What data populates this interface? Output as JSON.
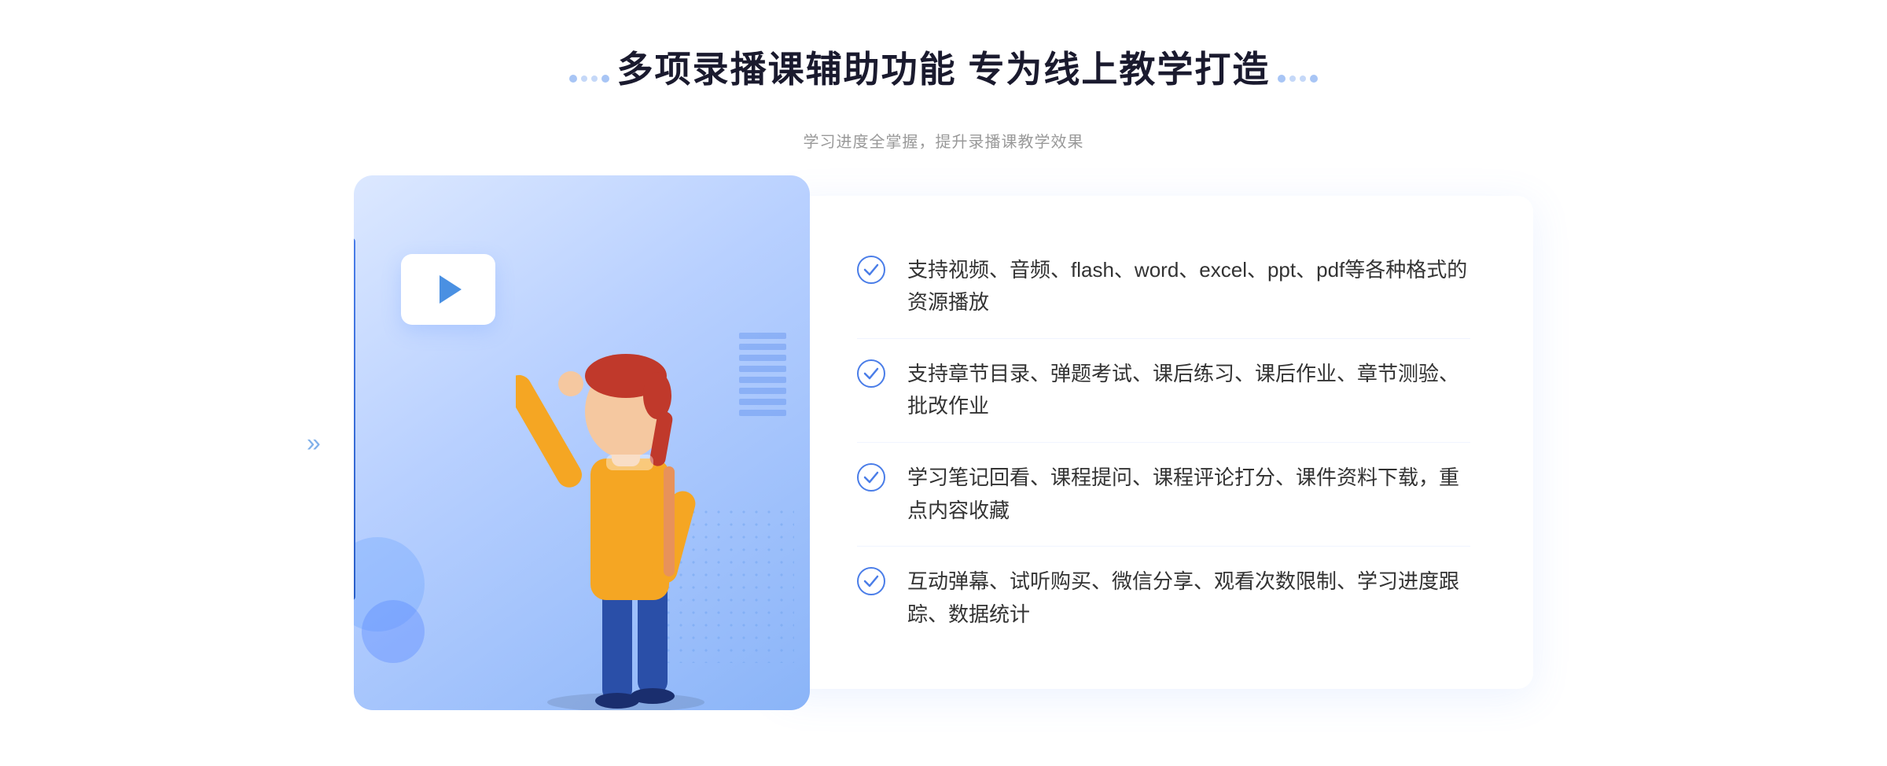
{
  "header": {
    "main_title": "多项录播课辅助功能 专为线上教学打造",
    "sub_title": "学习进度全掌握，提升录播课教学效果"
  },
  "features": [
    {
      "id": 1,
      "text": "支持视频、音频、flash、word、excel、ppt、pdf等各种格式的资源播放"
    },
    {
      "id": 2,
      "text": "支持章节目录、弹题考试、课后练习、课后作业、章节测验、批改作业"
    },
    {
      "id": 3,
      "text": "学习笔记回看、课程提问、课程评论打分、课件资料下载，重点内容收藏"
    },
    {
      "id": 4,
      "text": "互动弹幕、试听购买、微信分享、观看次数限制、学习进度跟踪、数据统计"
    }
  ],
  "colors": {
    "accent": "#4a7de8",
    "title": "#1a1a2e",
    "text": "#333333",
    "subtext": "#999999",
    "check": "#4a7de8",
    "bg_card": "#ffffff",
    "bg_illus": "#dce8ff"
  }
}
